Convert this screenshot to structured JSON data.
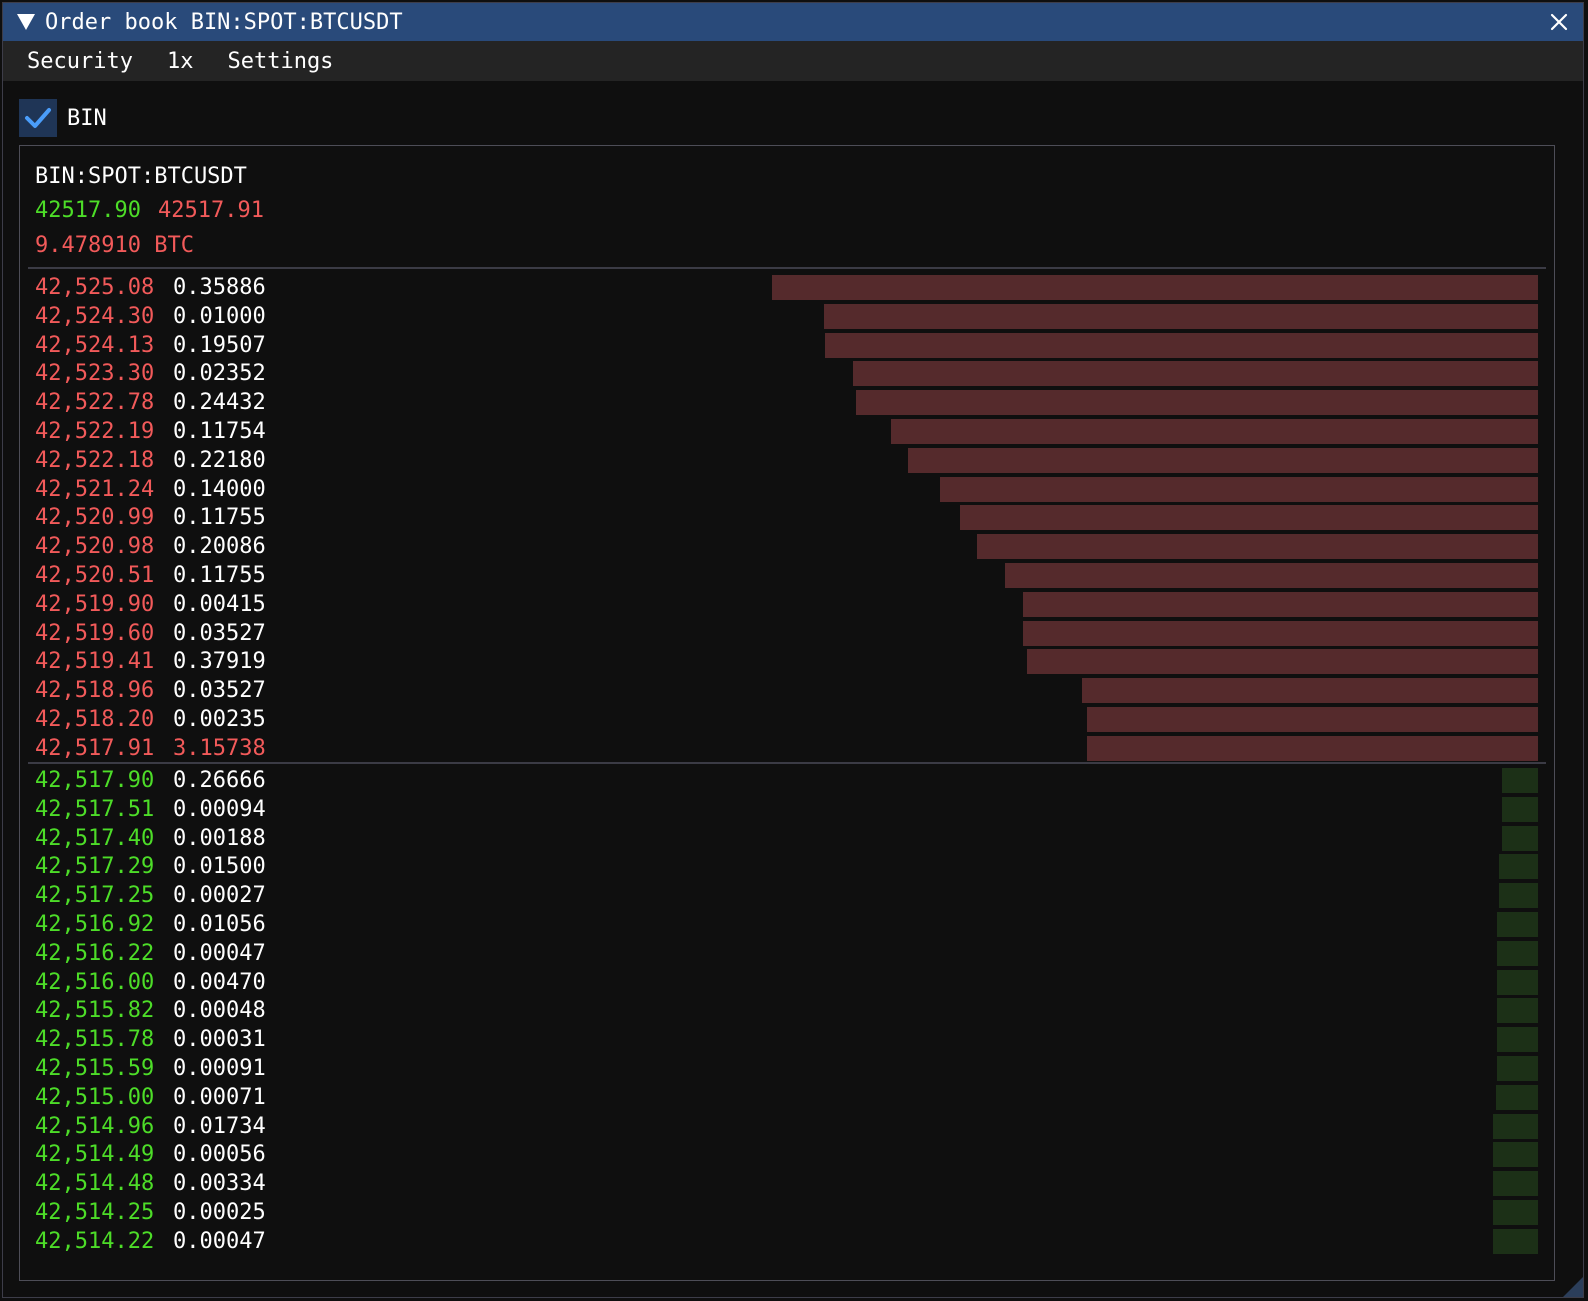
{
  "window": {
    "title": "Order book BIN:SPOT:BTCUSDT",
    "menu": [
      "Security",
      "1x",
      "Settings"
    ]
  },
  "exchange_toggle": {
    "label": "BIN",
    "checked": true
  },
  "book": {
    "symbol": "BIN:SPOT:BTCUSDT",
    "best_bid": "42517.90",
    "best_ask": "42517.91",
    "volume": "9.478910 BTC",
    "asks": [
      {
        "price": "42,525.08",
        "qty": "0.35886",
        "depth": 0.547
      },
      {
        "price": "42,524.30",
        "qty": "0.01000",
        "depth": 0.51
      },
      {
        "price": "42,524.13",
        "qty": "0.19507",
        "depth": 0.509
      },
      {
        "price": "42,523.30",
        "qty": "0.02352",
        "depth": 0.489
      },
      {
        "price": "42,522.78",
        "qty": "0.24432",
        "depth": 0.487
      },
      {
        "price": "42,522.19",
        "qty": "0.11754",
        "depth": 0.462
      },
      {
        "price": "42,522.18",
        "qty": "0.22180",
        "depth": 0.45
      },
      {
        "price": "42,521.24",
        "qty": "0.14000",
        "depth": 0.427
      },
      {
        "price": "42,520.99",
        "qty": "0.11755",
        "depth": 0.413
      },
      {
        "price": "42,520.98",
        "qty": "0.20086",
        "depth": 0.401
      },
      {
        "price": "42,520.51",
        "qty": "0.11755",
        "depth": 0.381
      },
      {
        "price": "42,519.90",
        "qty": "0.00415",
        "depth": 0.368
      },
      {
        "price": "42,519.60",
        "qty": "0.03527",
        "depth": 0.368
      },
      {
        "price": "42,519.41",
        "qty": "0.37919",
        "depth": 0.365
      },
      {
        "price": "42,518.96",
        "qty": "0.03527",
        "depth": 0.326
      },
      {
        "price": "42,518.20",
        "qty": "0.00235",
        "depth": 0.322
      },
      {
        "price": "42,517.91",
        "qty": "3.15738",
        "depth": 0.322
      }
    ],
    "bids": [
      {
        "price": "42,517.90",
        "qty": "0.26666",
        "depth": 0.026
      },
      {
        "price": "42,517.51",
        "qty": "0.00094",
        "depth": 0.026
      },
      {
        "price": "42,517.40",
        "qty": "0.00188",
        "depth": 0.026
      },
      {
        "price": "42,517.29",
        "qty": "0.01500",
        "depth": 0.028
      },
      {
        "price": "42,517.25",
        "qty": "0.00027",
        "depth": 0.028
      },
      {
        "price": "42,516.92",
        "qty": "0.01056",
        "depth": 0.029
      },
      {
        "price": "42,516.22",
        "qty": "0.00047",
        "depth": 0.029
      },
      {
        "price": "42,516.00",
        "qty": "0.00470",
        "depth": 0.029
      },
      {
        "price": "42,515.82",
        "qty": "0.00048",
        "depth": 0.029
      },
      {
        "price": "42,515.78",
        "qty": "0.00031",
        "depth": 0.029
      },
      {
        "price": "42,515.59",
        "qty": "0.00091",
        "depth": 0.029
      },
      {
        "price": "42,515.00",
        "qty": "0.00071",
        "depth": 0.03
      },
      {
        "price": "42,514.96",
        "qty": "0.01734",
        "depth": 0.032
      },
      {
        "price": "42,514.49",
        "qty": "0.00056",
        "depth": 0.032
      },
      {
        "price": "42,514.48",
        "qty": "0.00334",
        "depth": 0.032
      },
      {
        "price": "42,514.25",
        "qty": "0.00025",
        "depth": 0.032
      },
      {
        "price": "42,514.22",
        "qty": "0.00047",
        "depth": 0.032
      }
    ]
  },
  "colors": {
    "ask_text": "#f25a5a",
    "bid_text": "#4ddd28",
    "ask_bar": "#552a2c",
    "bid_bar": "#1c3017",
    "titlebar": "#294a7a",
    "check": "#4a9dfa"
  },
  "icons": {
    "collapse": "triangle-down-icon",
    "close": "close-icon",
    "check": "checkmark-icon"
  }
}
